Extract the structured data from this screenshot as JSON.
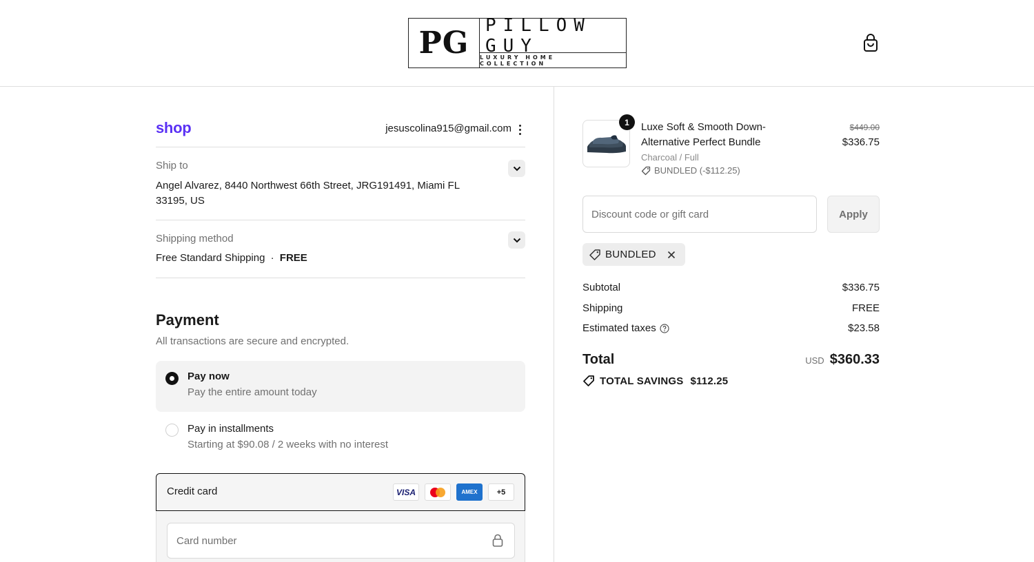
{
  "header": {
    "logo_monogram": "PG",
    "logo_name": "PILLOW GUY",
    "logo_tagline": "LUXURY HOME COLLECTION"
  },
  "account": {
    "shop_label": "shop",
    "email": "jesuscolina915@gmail.com"
  },
  "ship_to": {
    "label": "Ship to",
    "address_line1": "Angel Alvarez, 8440 Northwest 66th Street, JRG191491, Miami FL",
    "address_line2": "33195, US"
  },
  "shipping_method": {
    "label": "Shipping method",
    "name": "Free Standard Shipping",
    "separator": "·",
    "price": "FREE"
  },
  "payment": {
    "title": "Payment",
    "subtitle": "All transactions are secure and encrypted.",
    "options": [
      {
        "title": "Pay now",
        "desc": "Pay the entire amount today",
        "selected": true
      },
      {
        "title": "Pay in installments",
        "desc": "Starting at $90.08 / 2 weeks with no interest",
        "selected": false
      }
    ],
    "credit_card": {
      "label": "Credit card",
      "brands": [
        "VISA",
        "",
        "AMEX",
        "+5"
      ],
      "card_number_placeholder": "Card number"
    }
  },
  "order": {
    "item": {
      "quantity": "1",
      "name": "Luxe Soft & Smooth Down-Alternative Perfect Bundle",
      "variant": "Charcoal / Full",
      "discount": "BUNDLED (-$112.25)",
      "original_price": "$449.00",
      "price": "$336.75"
    },
    "discount_placeholder": "Discount code or gift card",
    "apply_label": "Apply",
    "applied_code": "BUNDLED",
    "subtotal_label": "Subtotal",
    "subtotal": "$336.75",
    "shipping_label": "Shipping",
    "shipping": "FREE",
    "taxes_label": "Estimated taxes",
    "taxes": "$23.58",
    "total_label": "Total",
    "currency": "USD",
    "total": "$360.33",
    "savings_label": "TOTAL SAVINGS",
    "savings": "$112.25"
  },
  "colors": {
    "shop_brand": "#5a31f4",
    "text": "#1a1a1a",
    "muted": "#707070",
    "border": "#dedede"
  }
}
